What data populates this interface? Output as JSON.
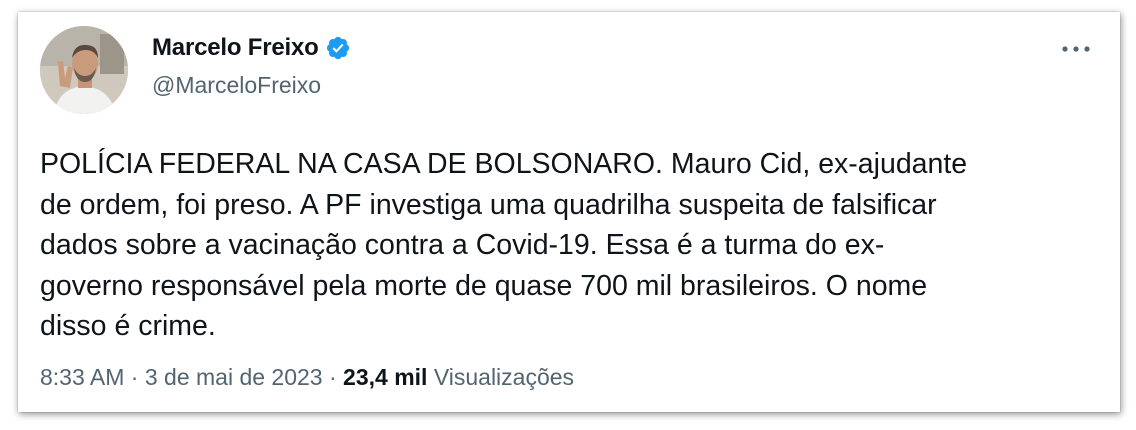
{
  "tweet": {
    "author": {
      "display_name": "Marcelo Freixo",
      "handle": "@MarceloFreixo",
      "verified": true,
      "verified_icon": "verified-badge-icon"
    },
    "more_icon": "more-horizontal-icon",
    "text": "POLÍCIA FEDERAL NA CASA DE BOLSONARO. Mauro Cid, ex-ajudante\nde ordem, foi preso. A PF investiga uma quadrilha suspeita de falsificar\ndados sobre a vacinação contra a Covid-19. Essa é a turma do ex-\ngoverno responsável pela morte de quase 700 mil brasileiros. O nome\ndisso é crime.",
    "meta": {
      "time": "8:33 AM",
      "separator": "·",
      "date": "3 de mai de 2023",
      "views_count": "23,4 mil",
      "views_label": "Visualizações"
    }
  },
  "colors": {
    "text_primary": "#0f1419",
    "text_secondary": "#536471",
    "verified_blue": "#1d9bf0"
  }
}
